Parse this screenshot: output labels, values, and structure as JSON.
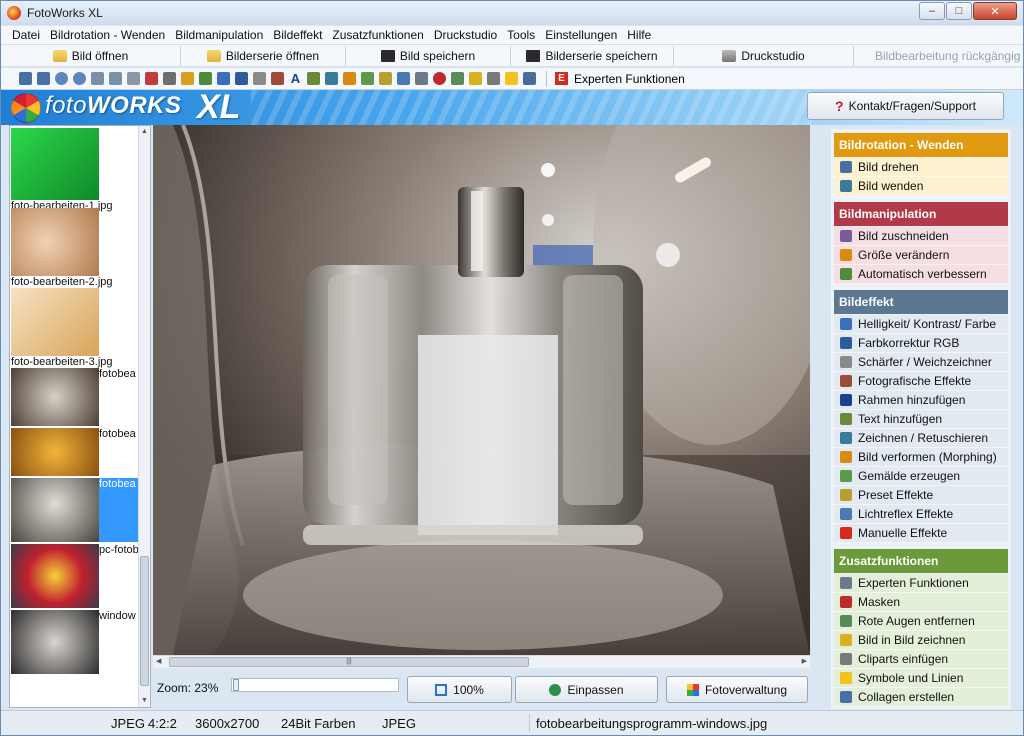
{
  "window": {
    "title": "FotoWorks XL",
    "min": "–",
    "max": "□",
    "close": "✕"
  },
  "menu": [
    "Datei",
    "Bildrotation - Wenden",
    "Bildmanipulation",
    "Bildeffekt",
    "Zusatzfunktionen",
    "Druckstudio",
    "Tools",
    "Einstellungen",
    "Hilfe"
  ],
  "toolbar1": {
    "open": "Bild öffnen",
    "open_series": "Bilderserie öffnen",
    "save": "Bild speichern",
    "save_series": "Bilderserie speichern",
    "print": "Druckstudio",
    "undo": "Bildbearbeitung rückgängig"
  },
  "toolbar2": {
    "expert": "Experten Funktionen"
  },
  "banner": {
    "logo_foto": "foto",
    "logo_works": "WORKS",
    "logo_xl": "XL",
    "support": "Kontakt/Fragen/Support"
  },
  "thumbnails": [
    {
      "label": "foto-bearbeiten-1.jpg",
      "selected": false
    },
    {
      "label": "foto-bearbeiten-2.jpg",
      "selected": false
    },
    {
      "label": "foto-bearbeiten-3.jpg",
      "selected": false
    },
    {
      "label": "fotobea",
      "selected": false
    },
    {
      "label": "fotobea",
      "selected": false
    },
    {
      "label": "fotobea",
      "selected": true
    },
    {
      "label": "pc-fotob",
      "selected": false
    },
    {
      "label": "window",
      "selected": false
    }
  ],
  "viewer": {
    "zoom_label": "Zoom: 23%",
    "zoom_level": 0.23,
    "btn_100": "100%",
    "btn_fit": "Einpassen",
    "btn_manage": "Fotoverwaltung"
  },
  "sections": [
    {
      "title": "Bildrotation - Wenden",
      "color": "#e19a10",
      "bg": "#fdf1cf",
      "items": [
        "Bild drehen",
        "Bild wenden"
      ]
    },
    {
      "title": "Bildmanipulation",
      "color": "#b23a48",
      "bg": "#f6dfe2",
      "items": [
        "Bild zuschneiden",
        "Größe verändern",
        "Automatisch verbessern"
      ]
    },
    {
      "title": "Bildeffekt",
      "color": "#5b7792",
      "bg": "#e2e9f1",
      "items": [
        "Helligkeit/ Kontrast/ Farbe",
        "Farbkorrektur RGB",
        "Schärfer / Weichzeichner",
        "Fotografische Effekte",
        "Rahmen hinzufügen",
        "Text hinzufügen",
        "Zeichnen / Retuschieren",
        "Bild verformen (Morphing)",
        "Gemälde erzeugen",
        "Preset Effekte",
        "Lichtreflex Effekte",
        "Manuelle Effekte"
      ]
    },
    {
      "title": "Zusatzfunktionen",
      "color": "#6a9a3a",
      "bg": "#e3efd8",
      "items": [
        "Experten Funktionen",
        "Masken",
        "Rote Augen entfernen",
        "Bild in Bild zeichnen",
        "Cliparts einfügen",
        "Symbole und Linien",
        "Collagen erstellen"
      ]
    }
  ],
  "status": {
    "format": "JPEG",
    "subsampling": "4:2:2",
    "dimensions": "3600x2700",
    "depth": "24Bit Farben",
    "type": "JPEG",
    "filename": "fotobearbeitungsprogramm-windows.jpg"
  }
}
